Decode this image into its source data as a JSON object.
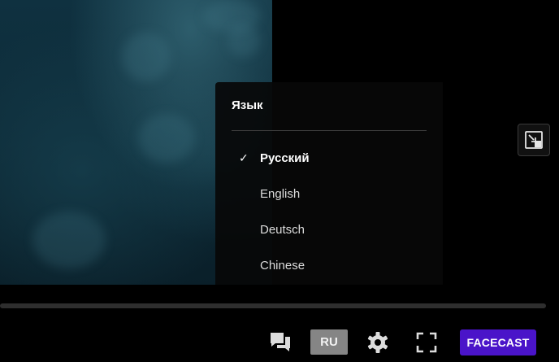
{
  "language_menu": {
    "title": "Язык",
    "items": [
      {
        "label": "Русский",
        "selected": true,
        "check": "✓"
      },
      {
        "label": "English",
        "selected": false
      },
      {
        "label": "Deutsch",
        "selected": false
      },
      {
        "label": "Chinese",
        "selected": false
      }
    ]
  },
  "controls": {
    "chat_icon": "chat-bubbles-icon",
    "language_button_label": "RU",
    "settings_icon": "gear-icon",
    "fullscreen_icon": "fullscreen-icon",
    "pip_icon": "picture-in-picture-icon",
    "brand_button_label": "FACECAST"
  },
  "progress": {
    "fraction": 0.0
  },
  "colors": {
    "brand": "#4a14c9",
    "language_button_bg": "#858585",
    "menu_bg": "#080808",
    "video_tint": "#0f3140"
  }
}
